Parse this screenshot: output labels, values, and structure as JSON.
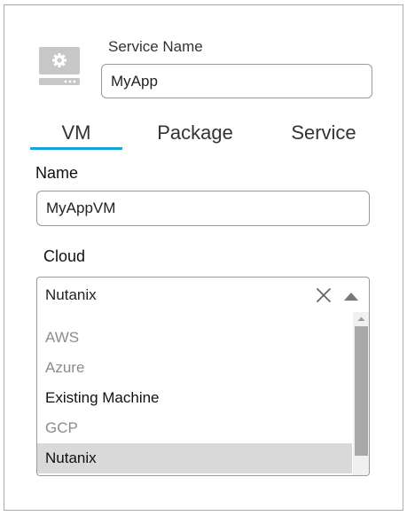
{
  "service": {
    "icon": "server-settings-icon",
    "label": "Service Name",
    "value": "MyApp"
  },
  "tabs": [
    {
      "label": "VM",
      "active": true
    },
    {
      "label": "Package",
      "active": false
    },
    {
      "label": "Service",
      "active": false
    }
  ],
  "accent_color": "#1aa3d9",
  "vm": {
    "name_label": "Name",
    "name_value": "MyAppVM",
    "cloud_label": "Cloud",
    "cloud_value": "Nutanix",
    "cloud_options": [
      {
        "label": "AWS",
        "state": "disabled"
      },
      {
        "label": "Azure",
        "state": "disabled"
      },
      {
        "label": "Existing Machine",
        "state": "enabled"
      },
      {
        "label": "GCP",
        "state": "disabled"
      },
      {
        "label": "Nutanix",
        "state": "selected"
      }
    ],
    "icons": {
      "clear": "close-icon",
      "toggle": "caret-up-icon",
      "scroll_up": "scroll-up-arrow-icon"
    }
  }
}
